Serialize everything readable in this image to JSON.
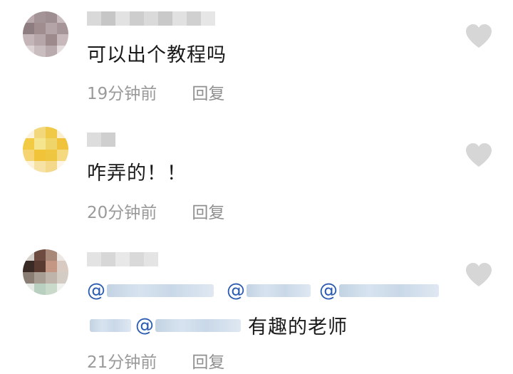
{
  "comments": [
    {
      "text": "可以出个教程吗",
      "time": "19分钟前",
      "reply": "回复"
    },
    {
      "text": "咋弄的！！",
      "time": "20分钟前",
      "reply": "回复"
    },
    {
      "mention_line1_at": [
        "@",
        "@",
        "@"
      ],
      "mention_line2_at": "@",
      "text_after": "有趣的老师",
      "time": "21分钟前",
      "reply": "回复"
    }
  ],
  "icons": {
    "like": "heart-icon"
  },
  "colors": {
    "text": "#1a1a1a",
    "meta": "#9a9a9a",
    "heart": "#d6d6d6",
    "mention": "#2a5bb0"
  }
}
